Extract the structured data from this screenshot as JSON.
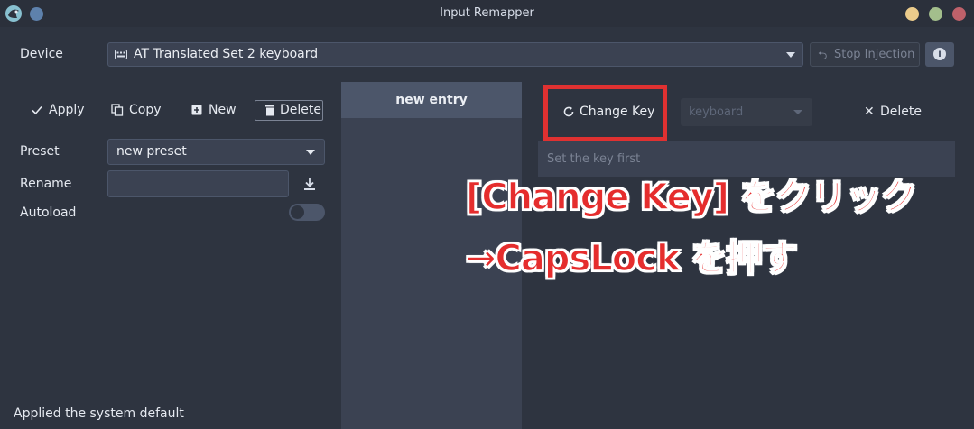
{
  "window": {
    "title": "Input Remapper"
  },
  "device": {
    "label": "Device",
    "selected": "AT Translated Set 2 keyboard",
    "stop_injection_label": "Stop Injection"
  },
  "preset_toolbar": {
    "apply_label": "Apply",
    "copy_label": "Copy",
    "new_label": "New",
    "delete_label": "Delete"
  },
  "preset": {
    "preset_label": "Preset",
    "preset_value": "new preset",
    "rename_label": "Rename",
    "rename_value": "",
    "autoload_label": "Autoload",
    "autoload_on": false
  },
  "mappings": {
    "entries": [
      {
        "label": "new entry"
      }
    ]
  },
  "editor": {
    "change_key_label": "Change Key",
    "target_type": "keyboard",
    "delete_label": "Delete",
    "key_placeholder": "Set the key first"
  },
  "status": {
    "text": "Applied the system default"
  },
  "annotation": {
    "line1": "[Change Key] をクリック",
    "line2": "→CapsLock を押す",
    "color": "#e52d2d"
  }
}
